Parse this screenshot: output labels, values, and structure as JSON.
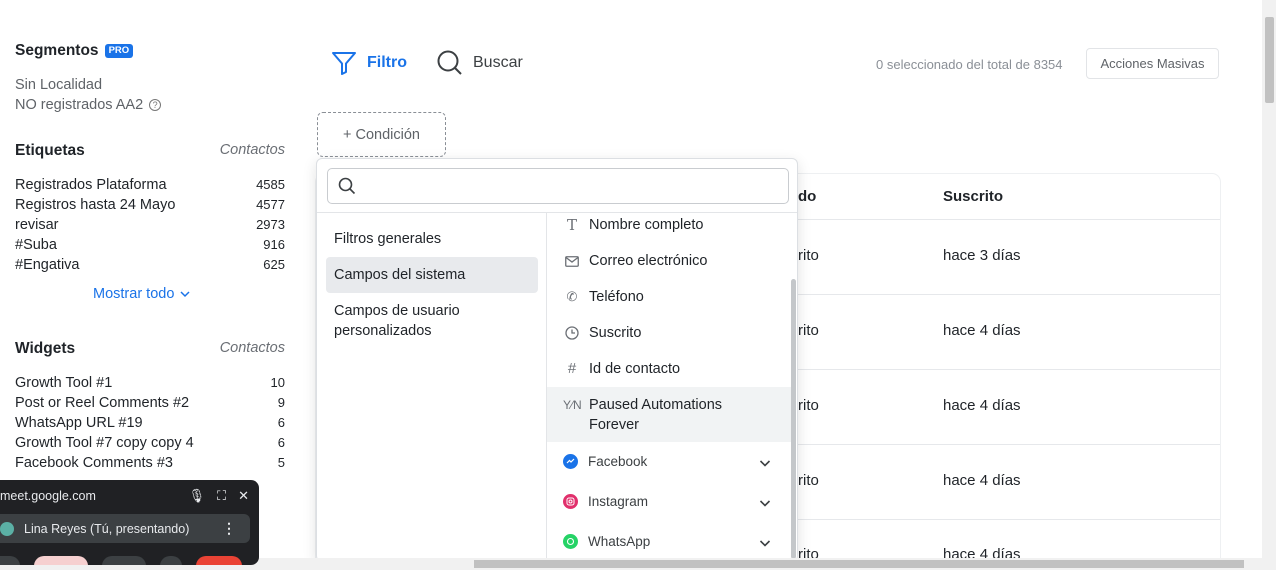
{
  "sidebar": {
    "segments": {
      "title": "Segmentos",
      "badge": "PRO",
      "items": [
        "Sin Localidad",
        "NO registrados AA2"
      ]
    },
    "tags": {
      "title": "Etiquetas",
      "subtitle": "Contactos",
      "rows": [
        {
          "label": "Registrados Plataforma",
          "count": "4585"
        },
        {
          "label": "Registros hasta 24 Mayo",
          "count": "4577"
        },
        {
          "label": "revisar",
          "count": "2973"
        },
        {
          "label": "#Suba",
          "count": "916"
        },
        {
          "label": "#Engativa",
          "count": "625"
        }
      ],
      "show_all": "Mostrar todo"
    },
    "widgets": {
      "title": "Widgets",
      "subtitle": "Contactos",
      "rows": [
        {
          "label": "Growth Tool #1",
          "count": "10"
        },
        {
          "label": "Post or Reel Comments #2",
          "count": "9"
        },
        {
          "label": "WhatsApp URL #19",
          "count": "6"
        },
        {
          "label": "Growth Tool #7 copy copy 4",
          "count": "6"
        },
        {
          "label": "Facebook Comments #3",
          "count": "5"
        }
      ]
    }
  },
  "toolbar": {
    "filter_label": "Filtro",
    "search_label": "Buscar",
    "selected_count": "0 seleccionado",
    "total_text": "del total de",
    "total": "8354",
    "mass_actions": "Acciones Masivas",
    "add_condition": "+ Condición"
  },
  "table": {
    "col_partial": "do",
    "col_subscribed": "Suscrito",
    "rows": [
      {
        "partial": "rito",
        "subscribed": "hace 3 días"
      },
      {
        "partial": "rito",
        "subscribed": "hace 4 días"
      },
      {
        "partial": "rito",
        "subscribed": "hace 4 días"
      },
      {
        "partial": "rito",
        "subscribed": "hace 4 días"
      },
      {
        "partial": "rito",
        "subscribed": "hace 4 días"
      }
    ]
  },
  "dropdown": {
    "search_placeholder": "",
    "categories": [
      "Filtros generales",
      "Campos del sistema",
      "Campos de usuario personalizados"
    ],
    "active_category": "Campos del sistema",
    "fields": [
      {
        "icon": "text-icon",
        "label": "Nombre completo"
      },
      {
        "icon": "mail-icon",
        "label": "Correo electrónico"
      },
      {
        "icon": "phone-icon",
        "label": "Teléfono"
      },
      {
        "icon": "clock-icon",
        "label": "Suscrito"
      },
      {
        "icon": "hash-icon",
        "label": "Id de contacto"
      },
      {
        "icon": "boolean-icon",
        "label": "Paused Automations Forever"
      }
    ],
    "channels": [
      {
        "icon": "messenger-icon",
        "label": "Facebook",
        "color": "#1a73e8"
      },
      {
        "icon": "instagram-icon",
        "label": "Instagram",
        "color": "#e1306c"
      },
      {
        "icon": "whatsapp-icon",
        "label": "WhatsApp",
        "color": "#25d366"
      }
    ]
  },
  "meet": {
    "url": "meet.google.com",
    "user": "Lina Reyes (Tú, presentando)"
  },
  "colors": {
    "accent": "#1a73e8",
    "meet_bg": "#202124"
  }
}
